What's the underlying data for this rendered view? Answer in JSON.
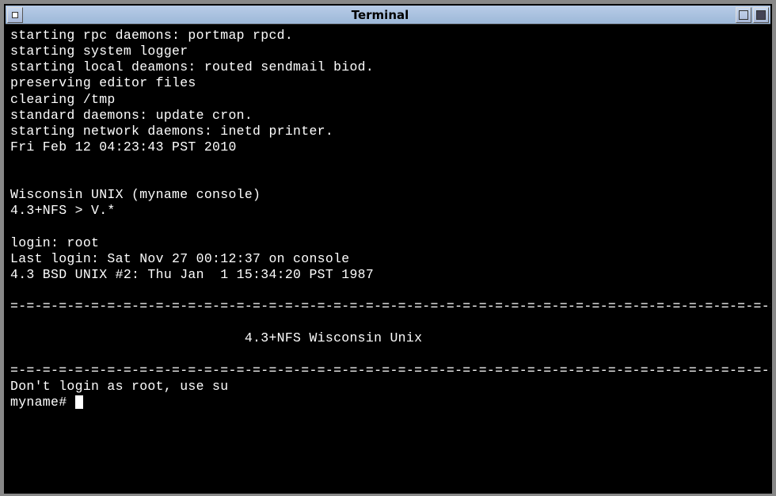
{
  "window": {
    "title": "Terminal"
  },
  "terminal": {
    "lines": [
      "starting rpc daemons: portmap rpcd.",
      "starting system logger",
      "starting local deamons: routed sendmail biod.",
      "preserving editor files",
      "clearing /tmp",
      "standard daemons: update cron.",
      "starting network daemons: inetd printer.",
      "Fri Feb 12 04:23:43 PST 2010",
      "",
      "",
      "Wisconsin UNIX (myname console)",
      "4.3+NFS > V.*",
      "",
      "login: root",
      "Last login: Sat Nov 27 00:12:37 on console",
      "4.3 BSD UNIX #2: Thu Jan  1 15:34:20 PST 1987"
    ],
    "separator": "=-=-=-=-=-=-=-=-=-=-=-=-=-=-=-=-=-=-=-=-=-=-=-=-=-=-=-=-=-=-=-=-=-=-=-=-=-=-=-=-=-=-=-=-=-=-=-=-",
    "banner": "                             4.3+NFS Wisconsin Unix",
    "warning": "Don't login as root, use su",
    "prompt": "myname# "
  }
}
